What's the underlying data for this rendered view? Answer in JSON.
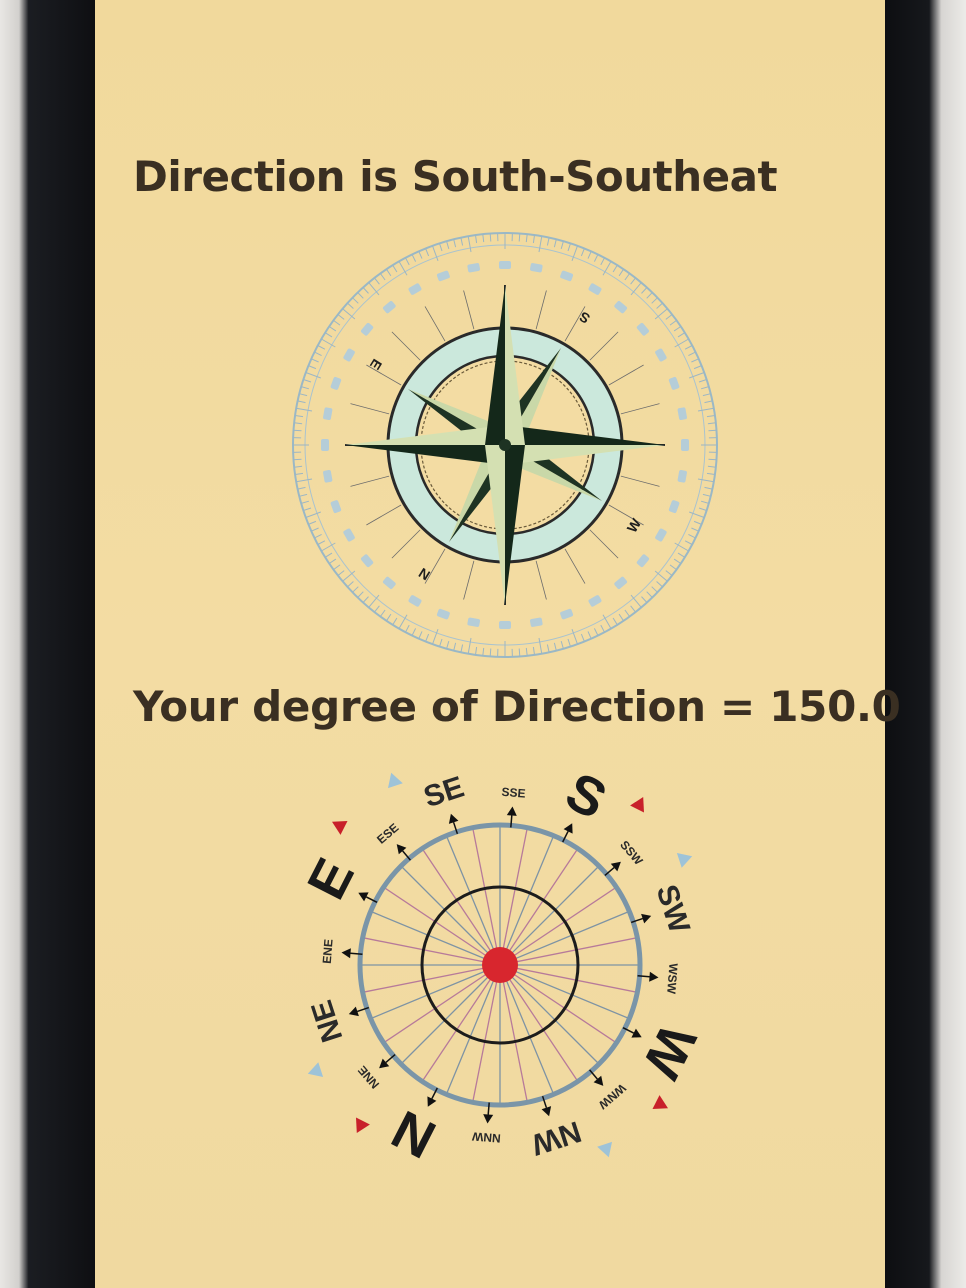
{
  "app": {
    "direction_text": "Direction is South-Southeat",
    "degree_text": "Your degree of Direction = 150.0"
  },
  "rose_compass": {
    "labels": {
      "s": "S",
      "w": "W",
      "n": "N",
      "e": "E"
    },
    "heading_deg": 150.0
  },
  "dial_compass": {
    "labels": {
      "n": "N",
      "nne": "NNE",
      "ne": "NE",
      "ene": "ENE",
      "e": "E",
      "ese": "ESE",
      "se": "SE",
      "sse": "SSE",
      "s": "S",
      "ssw": "SSW",
      "sw": "SW",
      "wsw": "WSW",
      "w": "W",
      "wnw": "WNW",
      "nw": "NW",
      "nnw": "NNW"
    },
    "center_color": "#d8262e",
    "accent_red": "#c8202a",
    "accent_blue": "#9ec3d8"
  }
}
